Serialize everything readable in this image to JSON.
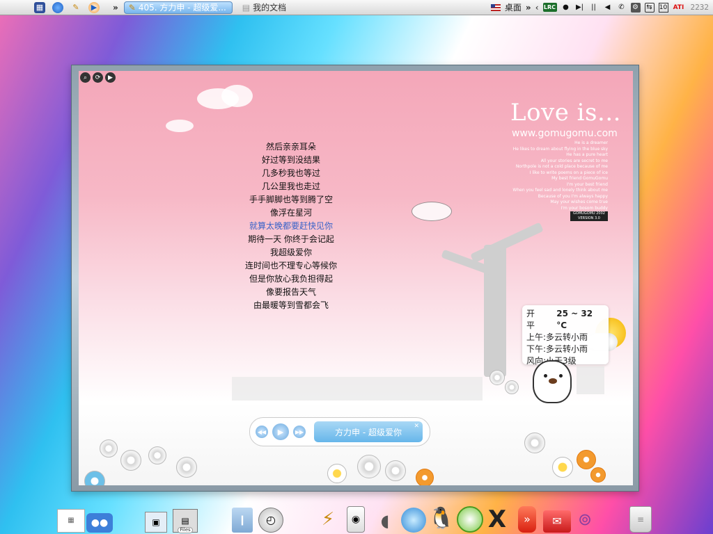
{
  "menubar": {
    "tasks": [
      {
        "label": "405. 方力申 - 超级爱...",
        "active": true
      },
      {
        "label": "我的文档",
        "active": false
      }
    ],
    "desktop_label": "桌面",
    "clock": "2232",
    "tray": {
      "lrc": "LRC",
      "ati": "ATI",
      "badge_10": "10"
    }
  },
  "player": {
    "lyrics": [
      "然后亲亲耳朵",
      "好过等到没结果",
      "几多秒我也等过",
      "几公里我也走过",
      "手手脚脚也等到腾了空",
      "像浮在星河",
      "就算太晚都要赶快见你",
      "期待一天 你终于会记起",
      "我超级爱你",
      "连时间也不理专心等候你",
      "但是你放心我负担得起",
      "像要报告天气",
      "由最暖等到雪都会飞"
    ],
    "current_lyric_index": 6,
    "skin": {
      "title": "Love is...",
      "url": "www.gomugomu.com",
      "poem": [
        "He is a dreamer",
        "He likes to dream about flying in the blue sky",
        "He has a pure heart",
        "All your stories are secret to me",
        "Northpole is not a cold place because of me",
        "I like to write poems on a piece of ice",
        "My best friend GomuGomu",
        "I'm your best friend",
        "When you feel sad and lonely think about me",
        "Because of you I'm always happy",
        "May your wishes come true",
        "I'm your bosom buddy"
      ],
      "badge_line1": "GOMUGOMU 2002",
      "badge_line2": "VERSION 3.0"
    },
    "weather": {
      "city": "开平",
      "temp": "25 ~ 32 °C",
      "morning": "上午:多云转小雨",
      "afternoon": "下午:多云转小雨",
      "wind": "风向:小于3级"
    },
    "controls": {
      "song_title": "方力申 - 超级爱你"
    }
  },
  "dock": {
    "files_label": "Files"
  },
  "colors": {
    "current_lyric": "#3a63c8",
    "skin_pink": "#f4a7b9",
    "control_blue": "#66b6ea"
  }
}
